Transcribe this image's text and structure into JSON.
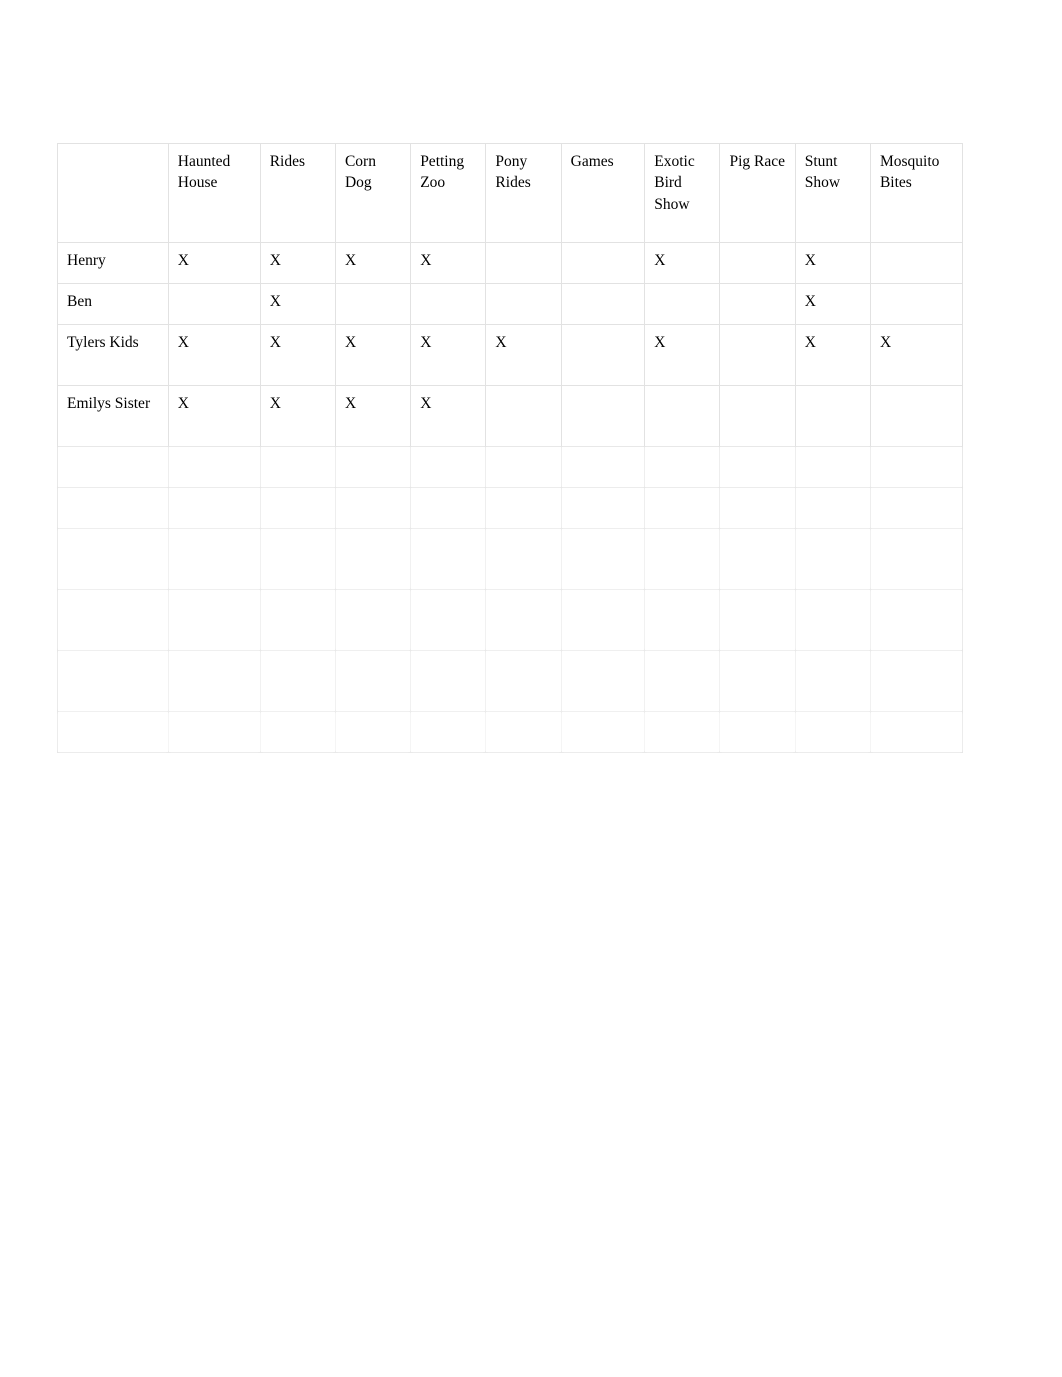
{
  "document": {
    "kind": "activity-checklist-table",
    "row_label_header": ""
  },
  "table": {
    "columns": [
      {
        "label": ""
      },
      {
        "label": "Haunted House"
      },
      {
        "label": "Rides"
      },
      {
        "label": "Corn Dog"
      },
      {
        "label": "Petting Zoo"
      },
      {
        "label": "Pony Rides"
      },
      {
        "label": "Games"
      },
      {
        "label": "Exotic Bird Show"
      },
      {
        "label": "Pig Race"
      },
      {
        "label": "Stunt Show"
      },
      {
        "label": "Mosquito Bites"
      }
    ],
    "mark": "X",
    "rows": [
      {
        "label": "Henry",
        "marks": [
          "X",
          "X",
          "X",
          "X",
          "",
          "",
          "X",
          "",
          "X",
          ""
        ]
      },
      {
        "label": "Ben",
        "marks": [
          "",
          "X",
          "",
          "",
          "",
          "",
          "",
          "",
          "X",
          ""
        ]
      },
      {
        "label": "Tylers Kids",
        "marks": [
          "X",
          "X",
          "X",
          "X",
          "X",
          "",
          "X",
          "",
          "X",
          "X"
        ]
      },
      {
        "label": "Emilys Sister",
        "marks": [
          "X",
          "X",
          "X",
          "X",
          "",
          "",
          "",
          "",
          "",
          ""
        ]
      }
    ],
    "faded_rows": [
      {
        "label": "",
        "marks": [
          "",
          "",
          "",
          "",
          "",
          "",
          "",
          "",
          "",
          ""
        ]
      },
      {
        "label": "",
        "marks": [
          "",
          "",
          "",
          "",
          "",
          "",
          "",
          "",
          "",
          ""
        ]
      },
      {
        "label": "",
        "marks": [
          "",
          "",
          "",
          "",
          "",
          "",
          "",
          "",
          "",
          ""
        ]
      },
      {
        "label": "",
        "marks": [
          "",
          "",
          "",
          "",
          "",
          "",
          "",
          "",
          "",
          ""
        ]
      },
      {
        "label": "",
        "marks": [
          "",
          "",
          "",
          "",
          "",
          "",
          "",
          "",
          "",
          ""
        ]
      },
      {
        "label": "",
        "marks": [
          "",
          "",
          "",
          "",
          "",
          "",
          "",
          "",
          "",
          ""
        ]
      }
    ]
  },
  "note": {
    "text": ""
  }
}
